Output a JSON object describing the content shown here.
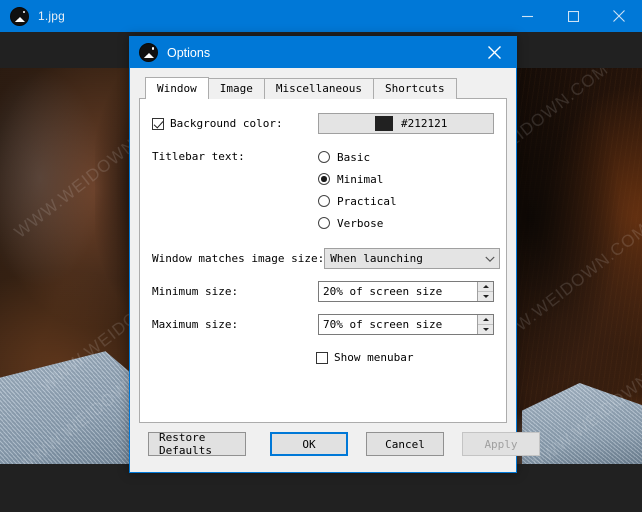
{
  "window": {
    "title": "1.jpg",
    "icon": "image-app-icon",
    "controls": [
      {
        "name": "minimize-button",
        "glyph": "minimize-icon"
      },
      {
        "name": "maximize-button",
        "glyph": "maximize-icon"
      },
      {
        "name": "close-button",
        "glyph": "close-icon"
      }
    ],
    "background_color": "#212121",
    "accent_color": "#0078d7"
  },
  "watermarks": [
    "WWW.WEIDOWN.COM",
    "WWW.WEIDOWN.COM",
    "WWW.WEIDOWN.COM",
    "WWW.WEIDOWN.COM",
    "WWW.WEIDOWN.COM",
    "WWW.WEIDOWN.COM"
  ],
  "dialog": {
    "title": "Options",
    "icon": "image-app-icon",
    "close_label": "close-icon",
    "tabs": [
      {
        "label": "Window",
        "selected": true
      },
      {
        "label": "Image",
        "selected": false
      },
      {
        "label": "Miscellaneous",
        "selected": false
      },
      {
        "label": "Shortcuts",
        "selected": false
      }
    ],
    "window_tab": {
      "background_color": {
        "label": "Background color:",
        "checked": true,
        "swatch_color": "#212121",
        "hex_value": "#212121"
      },
      "titlebar_text": {
        "label": "Titlebar text:",
        "options": [
          {
            "label": "Basic",
            "selected": false
          },
          {
            "label": "Minimal",
            "selected": true
          },
          {
            "label": "Practical",
            "selected": false
          },
          {
            "label": "Verbose",
            "selected": false
          }
        ]
      },
      "window_matches_image_size": {
        "label": "Window matches image size:",
        "value": "When launching"
      },
      "minimum_size": {
        "label": "Minimum size:",
        "value": "20% of screen size"
      },
      "maximum_size": {
        "label": "Maximum size:",
        "value": "70% of screen size"
      },
      "show_menubar": {
        "label": "Show menubar",
        "checked": false
      }
    },
    "buttons": {
      "restore_defaults": "Restore Defaults",
      "ok": "OK",
      "cancel": "Cancel",
      "apply": "Apply"
    }
  }
}
